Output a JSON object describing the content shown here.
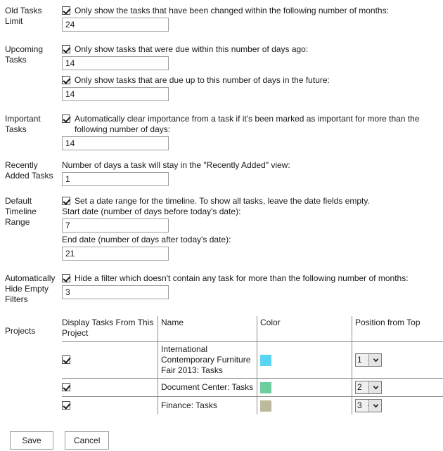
{
  "sections": [
    {
      "key": "old_tasks_limit",
      "label": "Old Tasks Limit",
      "checkbox_label": "Only show the tasks that have been changed within the following number of months:",
      "checked": true,
      "value": "24"
    },
    {
      "key": "upcoming_tasks",
      "label": "Upcoming Tasks",
      "checkbox_label_1": "Only show tasks that were due within this number of days ago:",
      "checked_1": true,
      "value_1": "14",
      "checkbox_label_2": "Only show tasks that are due up to this number of days in the future:",
      "checked_2": true,
      "value_2": "14"
    },
    {
      "key": "important_tasks",
      "label": "Important Tasks",
      "checkbox_label": "Automatically clear importance from a task if it's been marked as important for more than the following number of days:",
      "checked": true,
      "value": "14"
    },
    {
      "key": "recently_added_tasks",
      "label": "Recently Added Tasks",
      "caption": "Number of days a task will stay in the \"Recently Added\" view:",
      "value": "1"
    },
    {
      "key": "default_timeline_range",
      "label": "Default Timeline Range",
      "checkbox_label": "Set a date range for the timeline. To show all tasks, leave the date fields empty.",
      "checked": true,
      "start_caption": "Start date (number of days before today's date):",
      "start_value": "7",
      "end_caption": "End date (number of days after today's date):",
      "end_value": "21"
    },
    {
      "key": "auto_hide_empty_filters",
      "label": "Automatically Hide Empty Filters",
      "checkbox_label": "Hide a filter which doesn't contain any task for more than the following number of months:",
      "checked": true,
      "value": "3"
    }
  ],
  "projects": {
    "label": "Projects",
    "headers": {
      "display": "Display Tasks From This Project",
      "name": "Name",
      "color": "Color",
      "position": "Position from Top"
    },
    "rows": [
      {
        "display_checked": true,
        "name": "International Contemporary Furniture Fair 2013: Tasks",
        "color": "#5ad4f0",
        "position": "1",
        "position_options": [
          "1",
          "2",
          "3"
        ]
      },
      {
        "display_checked": true,
        "name": "Document Center: Tasks",
        "color": "#6ecd9e",
        "position": "2",
        "position_options": [
          "1",
          "2",
          "3"
        ]
      },
      {
        "display_checked": true,
        "name": "Finance: Tasks",
        "color": "#bdb99c",
        "position": "3",
        "position_options": [
          "1",
          "2",
          "3"
        ]
      }
    ]
  },
  "footer": {
    "save_label": "Save",
    "cancel_label": "Cancel"
  }
}
